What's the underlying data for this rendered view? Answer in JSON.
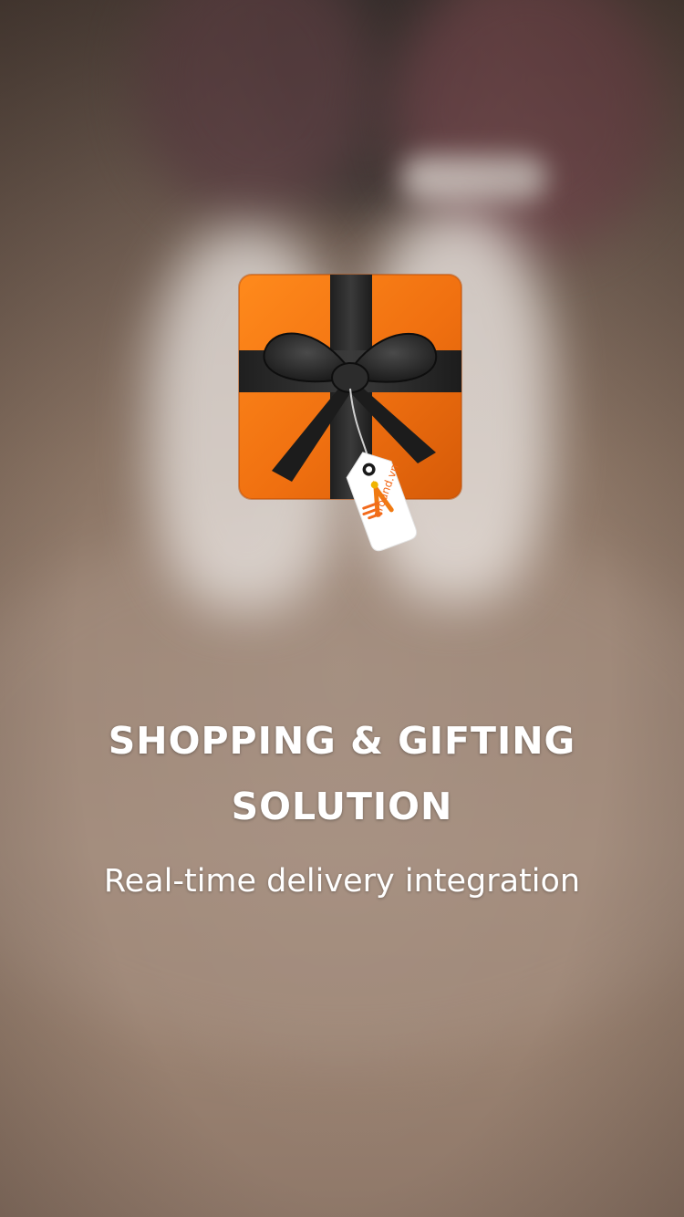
{
  "splash": {
    "headline_line1": "SHOPPING & GIFTING",
    "headline_line2": "SOLUTION",
    "tagline": "Real-time delivery integration"
  },
  "logo": {
    "tag_text": "around.vn",
    "icon": "gift-box-icon",
    "colors": {
      "box": "#f07a12",
      "ribbon": "#2a2a2a",
      "tag": "#ffffff",
      "brand": "#f26a1b"
    }
  },
  "background": {
    "description_icon": "hands-photo-background"
  }
}
